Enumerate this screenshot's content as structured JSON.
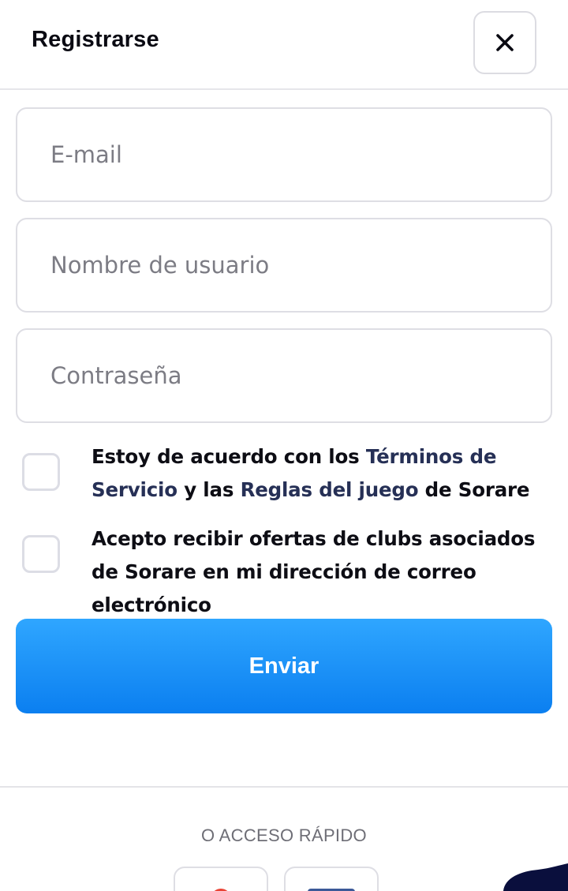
{
  "header": {
    "title": "Registrarse",
    "close_icon": "close-icon"
  },
  "form": {
    "email_placeholder": "E-mail",
    "username_placeholder": "Nombre de usuario",
    "password_placeholder": "Contraseña"
  },
  "terms": {
    "text_before": "Estoy de acuerdo con los ",
    "terms_link": "Términos de Servicio",
    "text_middle": " y las ",
    "rules_link": "Reglas del juego",
    "text_after": " de Sorare",
    "checked": false
  },
  "offers": {
    "text": "Acepto recibir ofertas de clubs asociados de Sorare en mi dirección de correo electrónico",
    "checked": false
  },
  "submit": {
    "label": "Enviar"
  },
  "quick_access": {
    "label": "O ACCESO RÁPIDO",
    "buttons": [
      "google-icon",
      "facebook-icon"
    ]
  },
  "colors": {
    "link": "#263056",
    "button_top": "#2fa6ff",
    "button_bottom": "#0b7ff0"
  }
}
